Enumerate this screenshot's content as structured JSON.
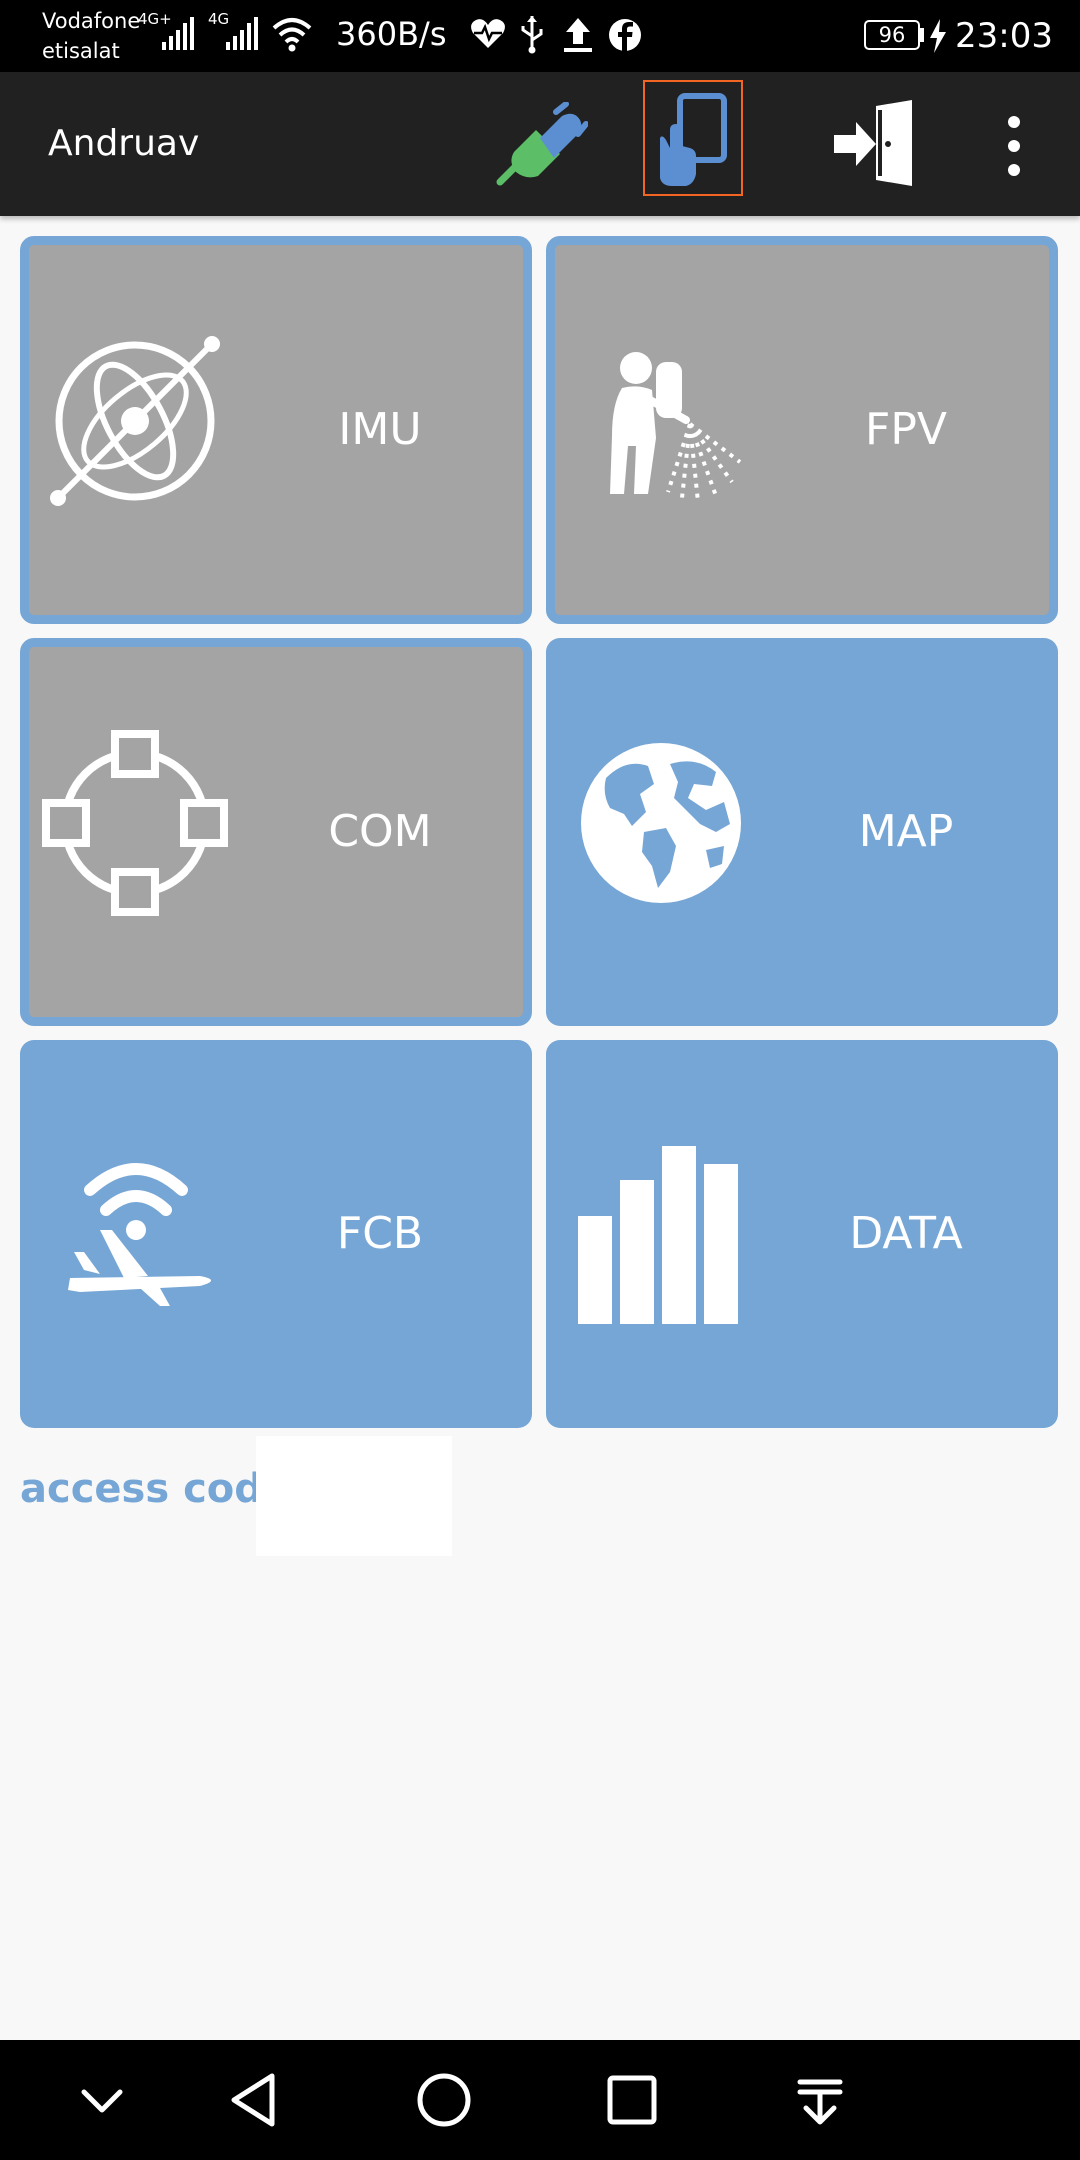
{
  "status_bar": {
    "carrier_1": "Vodafone",
    "carrier_2": "etisalat",
    "net_1": "4G+",
    "net_2": "4G",
    "speed": "360B/s",
    "battery": "96",
    "time": "23:03",
    "icons": [
      "signal-icon",
      "signal-icon",
      "wifi-icon",
      "heartbeat-icon",
      "usb-icon",
      "upload-icon",
      "facebook-icon",
      "battery-icon",
      "charging-icon"
    ]
  },
  "app_bar": {
    "title": "Andruav",
    "actions": [
      "plug-connected-icon",
      "hand-tablet-icon",
      "exit-door-icon",
      "more-vert-icon"
    ]
  },
  "tiles": [
    {
      "label": "IMU",
      "icon": "gyroscope-icon",
      "state": "gray"
    },
    {
      "label": "FPV",
      "icon": "sprayer-person-icon",
      "state": "gray"
    },
    {
      "label": "COM",
      "icon": "network-nodes-icon",
      "state": "gray"
    },
    {
      "label": "MAP",
      "icon": "globe-icon",
      "state": "blue"
    },
    {
      "label": "FCB",
      "icon": "plane-wifi-icon",
      "state": "blue"
    },
    {
      "label": "DATA",
      "icon": "bar-chart-icon",
      "state": "blue"
    }
  ],
  "access": {
    "label": "access code:",
    "value": ""
  },
  "nav_bar": {
    "buttons": [
      "chevron-down-icon",
      "back-icon",
      "home-icon",
      "recents-icon",
      "notification-pull-icon"
    ]
  },
  "colors": {
    "tile_blue": "#76a6d5",
    "tile_gray": "#a4a4a4",
    "app_bar": "#212121",
    "selected_outline": "#f26522",
    "plug_green": "#5cbf68"
  }
}
